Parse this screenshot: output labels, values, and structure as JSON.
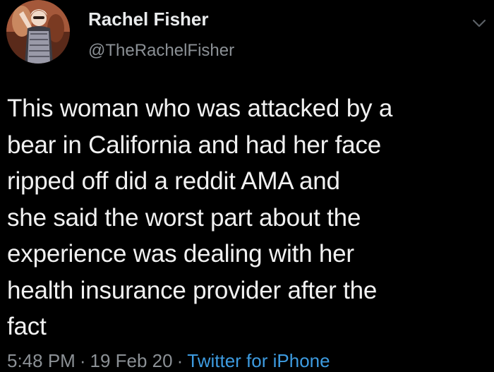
{
  "user": {
    "display_name": "Rachel Fisher",
    "handle": "@TheRachelFisher"
  },
  "tweet": {
    "lines": [
      "This woman who was attacked by a",
      "bear in California and had her face",
      "ripped off did a reddit AMA and",
      "she said the worst part about the",
      "experience was dealing with her",
      "health insurance provider after the",
      "fact"
    ]
  },
  "meta": {
    "time": "5:48 PM",
    "separator": "·",
    "date": "19 Feb 20",
    "source": "Twitter for iPhone"
  },
  "colors": {
    "background": "#000000",
    "text": "#e9ebec",
    "secondary": "#8b9095",
    "link": "#3d9be0"
  },
  "icons": {
    "menu": "chevron-down-icon"
  }
}
